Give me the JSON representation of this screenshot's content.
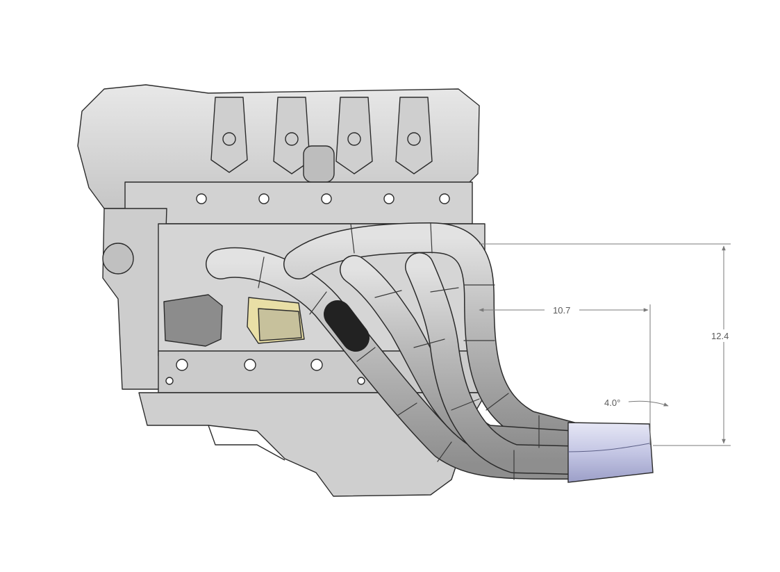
{
  "drawing": {
    "dimensions": {
      "horizontal": "10.7",
      "vertical": "12.4",
      "angle": "4.0°"
    },
    "colors": {
      "background": "#ffffff",
      "engine_line": "#2b2b2b",
      "engine_fill": "#d9d9d9",
      "pipe_fill": "#b8b8b8",
      "collector_fill": "#c7c9e6",
      "gasket_fill": "#e9dfa6",
      "dimension_line": "#7a7a7a"
    }
  }
}
